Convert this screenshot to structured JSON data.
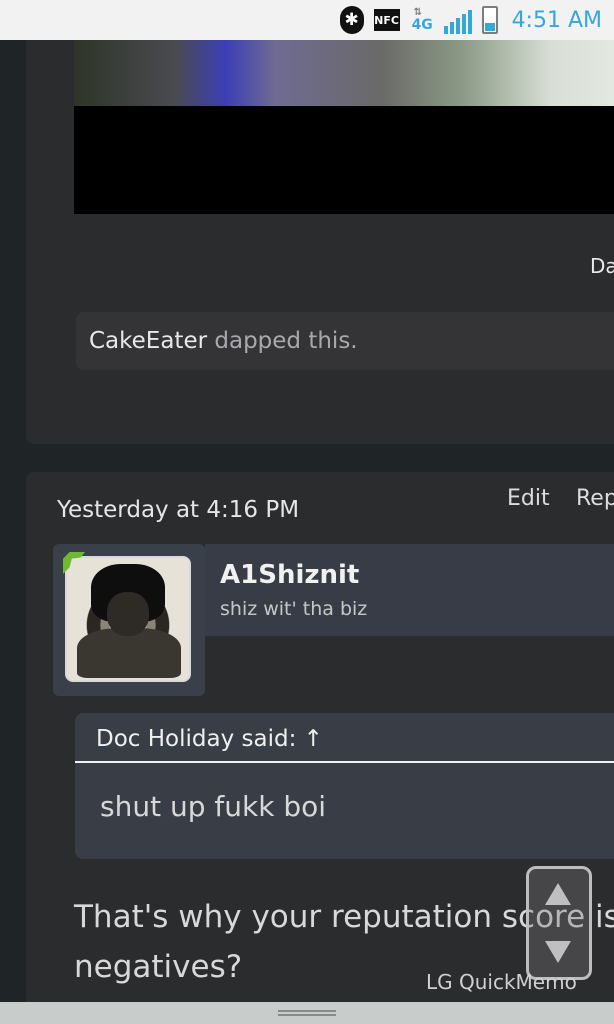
{
  "status_bar": {
    "bluetooth_icon": "bluetooth-icon",
    "nfc_label": "NFC",
    "network_label": "4G",
    "time": "4:51 AM"
  },
  "card1": {
    "partial_text": "Da",
    "likes": {
      "user": "CakeEater",
      "text": " dapped this."
    }
  },
  "post": {
    "date": "Yesterday at 4:16 PM",
    "edit_label": "Edit",
    "reply_label": "Rep",
    "author": "A1Shiznit",
    "author_title": "shiz wit' tha biz",
    "quote": {
      "header": "Doc Holiday said: ↑",
      "body": "shut up fukk boi"
    },
    "message": "That's why your reputation score is negatives?"
  },
  "overlay": {
    "memo_label": "LG QuickMemo"
  },
  "colors": {
    "accent": "#35a7d8",
    "background": "#1f2426",
    "card": "#2b2c2e",
    "quote": "#383d46",
    "avatar_badge": "#6fb832"
  }
}
